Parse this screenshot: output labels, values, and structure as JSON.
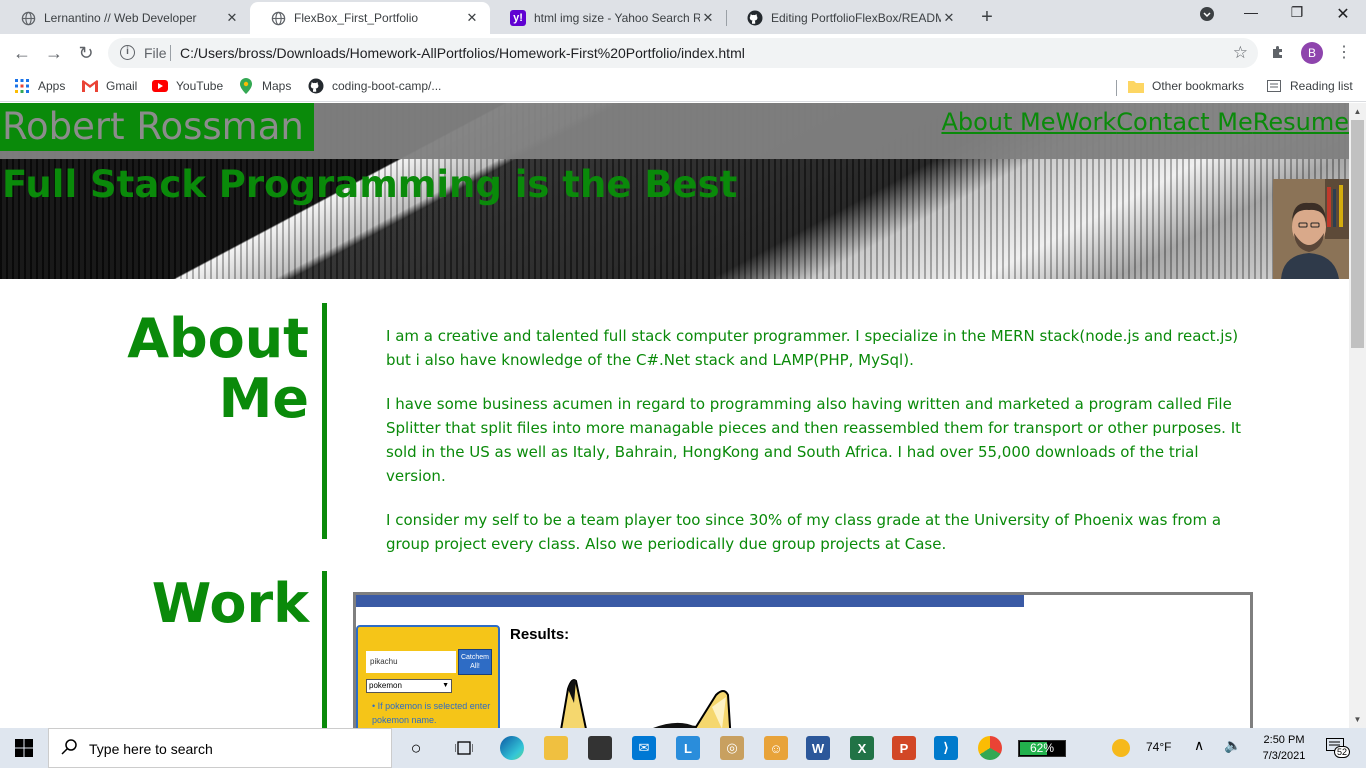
{
  "browser": {
    "tabs": [
      {
        "title": "Lernantino // Web Developer",
        "active": false
      },
      {
        "title": "FlexBox_First_Portfolio",
        "active": true
      },
      {
        "title": "html img size - Yahoo Search Res",
        "active": false
      },
      {
        "title": "Editing PortfolioFlexBox/READM",
        "active": false
      }
    ],
    "address": {
      "scheme": "File",
      "url": "C:/Users/bross/Downloads/Homework-AllPortfolios/Homework-First%20Portfolio/index.html"
    },
    "profile_initial": "B",
    "bookmarks": [
      "Apps",
      "Gmail",
      "YouTube",
      "Maps",
      "coding-boot-camp/..."
    ],
    "other_bookmarks": "Other bookmarks",
    "reading_list": "Reading list"
  },
  "site": {
    "name": "Robert Rossman",
    "nav": [
      "About Me",
      "Work",
      "Contact Me",
      "Resume"
    ],
    "tagline": "Full Stack Programming is the Best",
    "about": {
      "title_line1": "About",
      "title_line2": "Me",
      "paragraphs": [
        "I am a creative and talented full stack computer programmer. I specialize in the MERN stack(node.js and react.js) but i also have knowledge of the C#.Net stack and LAMP(PHP, MySql).",
        "I have some business acumen in regard to programming also having written and marketed a program called File Splitter that split files into more managable pieces and then reassembled them for transport or other purposes. It sold in the US as well as Italy, Bahrain, HongKong and South Africa. I had over 55,000 downloads of the trial version.",
        "I consider my self to be a team player too since 30% of my class grade at the University of Phoenix was from a group project every class. Also we periodically due group projects at Case."
      ]
    },
    "work": {
      "title": "Work",
      "app": {
        "input_value": "pikachu",
        "button_label": "Catchem All!",
        "select_value": "pokemon",
        "hint": "If pokemon is selected enter pokemon name.",
        "results_label": "Results:"
      }
    }
  },
  "taskbar": {
    "search_placeholder": "Type here to search",
    "battery_percent": 62,
    "battery_label": "62%",
    "weather": "74°F",
    "time": "2:50 PM",
    "date": "7/3/2021",
    "notifications": "52"
  },
  "colors": {
    "site_green": "#0a8a0a",
    "header_gray": "#808080",
    "work_bar_blue": "#3a5aa5",
    "pokemon_yellow": "#f5c518"
  }
}
